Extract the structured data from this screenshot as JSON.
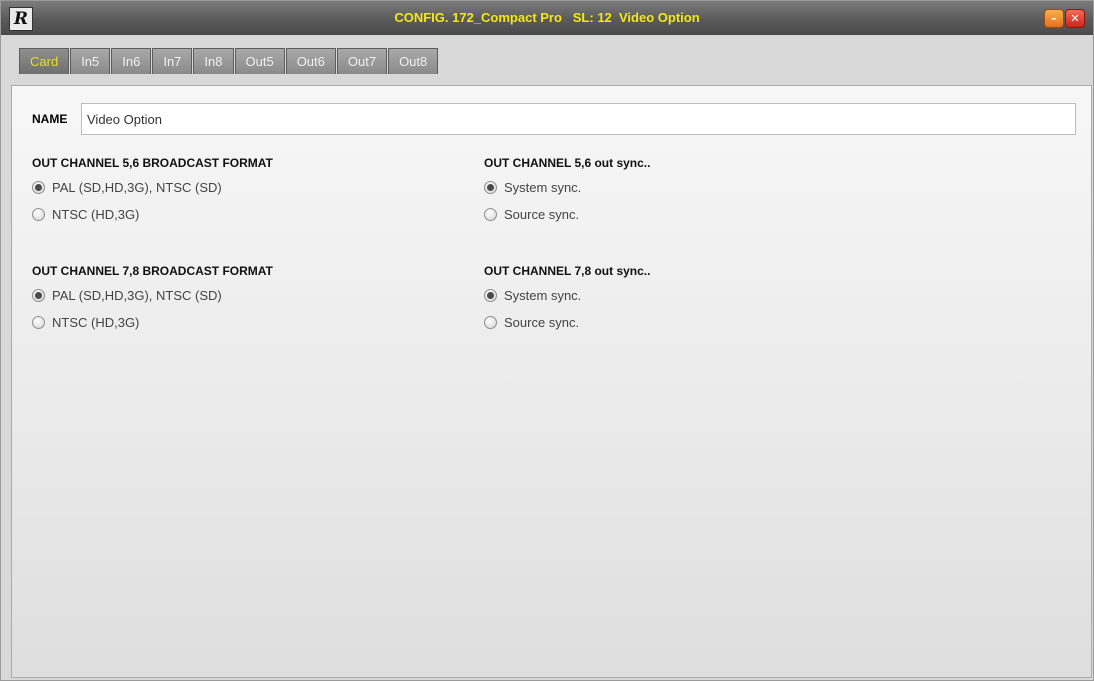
{
  "window": {
    "title": "CONFIG. 172_Compact Pro   SL: 12  Video Option",
    "logo": "R",
    "minimize_icon": "–",
    "close_icon": "✕"
  },
  "tabs": [
    {
      "label": "Card",
      "active": true
    },
    {
      "label": "In5",
      "active": false
    },
    {
      "label": "In6",
      "active": false
    },
    {
      "label": "In7",
      "active": false
    },
    {
      "label": "In8",
      "active": false
    },
    {
      "label": "Out5",
      "active": false
    },
    {
      "label": "Out6",
      "active": false
    },
    {
      "label": "Out7",
      "active": false
    },
    {
      "label": "Out8",
      "active": false
    }
  ],
  "name_field": {
    "label": "NAME",
    "value": "Video Option"
  },
  "sections": {
    "fmt56": {
      "title": "OUT CHANNEL 5,6  BROADCAST FORMAT",
      "options": [
        {
          "label": "PAL (SD,HD,3G), NTSC  (SD)",
          "checked": true
        },
        {
          "label": "NTSC (HD,3G)",
          "checked": false
        }
      ]
    },
    "sync56": {
      "title": "OUT CHANNEL 5,6  out sync..",
      "options": [
        {
          "label": "System sync.",
          "checked": true
        },
        {
          "label": "Source sync.",
          "checked": false
        }
      ]
    },
    "fmt78": {
      "title": "OUT CHANNEL 7,8  BROADCAST FORMAT",
      "options": [
        {
          "label": "PAL (SD,HD,3G), NTSC  (SD)",
          "checked": true
        },
        {
          "label": "NTSC (HD,3G)",
          "checked": false
        }
      ]
    },
    "sync78": {
      "title": "OUT CHANNEL 7,8  out sync..",
      "options": [
        {
          "label": "System sync.",
          "checked": true
        },
        {
          "label": "Source sync.",
          "checked": false
        }
      ]
    }
  },
  "colors": {
    "title_text": "#f3e61c",
    "active_tab_text": "#e5e12a",
    "close_button": "#d9352a",
    "minimize_button": "#f0902c"
  },
  "icons": [
    "app-logo-icon",
    "minimize-icon",
    "close-icon",
    "radio-checked-icon",
    "radio-unchecked-icon"
  ]
}
